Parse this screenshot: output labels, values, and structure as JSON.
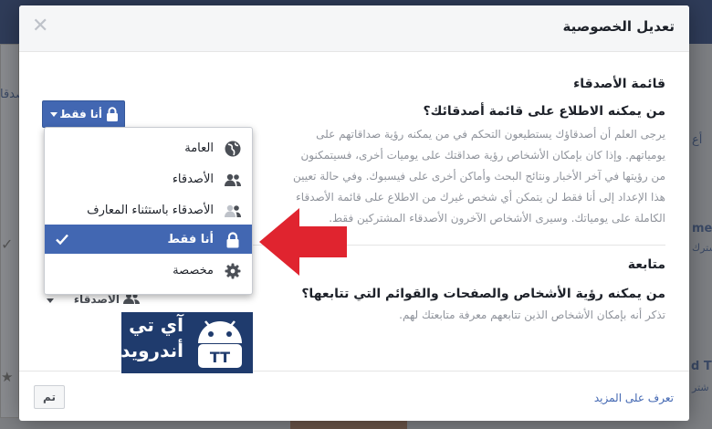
{
  "dialog": {
    "title": "تعديل الخصوصية",
    "close_icon": "close-icon"
  },
  "friends_list": {
    "section_title": "قائمة الأصدقاء",
    "question": "من يمكنه الاطلاع على قائمة أصدقائك؟",
    "description_lines": [
      "يرجى العلم أن أصدقاؤك يستطيعون التحكم في من يمكنه رؤية صداقاتهم على",
      "يومياتهم. وإذا كان بإمكان الأشخاص رؤية صداقتك على يوميات أخرى، فسيتمكنون",
      "من رؤيتها في آخر الأخبار ونتائج البحث وأماكن أخرى على فيسبوك. وفي حالة تعيين",
      "هذا الإعداد إلى أنا فقط لن يتمكن أي شخص غيرك من الاطلاع على قائمة الأصدقاء",
      "الكاملة على يومياتك. وسيرى الأشخاص الآخرون الأصدقاء المشتركين فقط."
    ],
    "selector_label": "أنا فقط"
  },
  "audience_menu": {
    "items": [
      {
        "label": "العامة",
        "icon": "globe-icon",
        "selected": false
      },
      {
        "label": "الأصدقاء",
        "icon": "friends-icon",
        "selected": false
      },
      {
        "label": "الأصدقاء باستثناء المعارف",
        "icon": "friends-except-icon",
        "selected": false
      },
      {
        "label": "أنا فقط",
        "icon": "lock-icon",
        "selected": true
      },
      {
        "label": "مخصصة",
        "icon": "gear-icon",
        "selected": false
      }
    ]
  },
  "followers": {
    "section_title": "متابعة",
    "question": "من يمكنه رؤية الأشخاص والصفحات والقوائم التي تتابعها؟",
    "description": "تذكر أنه بإمكان الأشخاص الذين تتابعهم معرفة متابعتك لهم.",
    "selector_label": "الأصدقاء"
  },
  "watermark": {
    "line1": "آي تي",
    "line2": "أندرويد",
    "badge": "TT"
  },
  "footer": {
    "learn_more": "تعرف على المزيد",
    "done_label": "تم"
  },
  "background": {
    "left_fragment": "صدقا",
    "right_fragment_1": "أع",
    "right_fragment_2": "me",
    "right_fragment_3": "مشترك",
    "right_fragment_4": "d T",
    "right_fragment_5": "شتر"
  },
  "colors": {
    "accent": "#4267b2",
    "arrow": "#e0242f",
    "logo_bg": "#1f3b6d"
  }
}
